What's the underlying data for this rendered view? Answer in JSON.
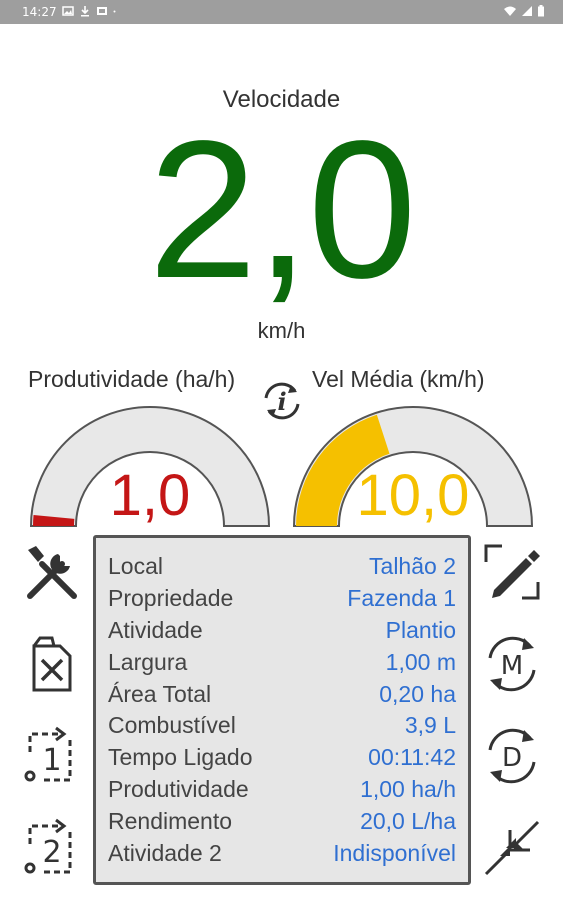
{
  "status_bar": {
    "time": "14:27",
    "left_icons": [
      "image-icon",
      "download-icon",
      "screenshot-icon",
      "dot-icon"
    ],
    "right_icons": [
      "wifi-icon",
      "signal-icon",
      "battery-icon"
    ]
  },
  "speed": {
    "label": "Velocidade",
    "value": "2,0",
    "unit": "km/h",
    "color": "#0b6a0b"
  },
  "gauges": {
    "productivity": {
      "label": "Produtividade (ha/h)",
      "value": "1,0",
      "fill_fraction": 0.03,
      "color": "#c41616"
    },
    "avg_speed": {
      "label": "Vel Média (km/h)",
      "value": "10,0",
      "fill_fraction": 0.4,
      "color": "#f5c000"
    }
  },
  "info_panel": {
    "rows": [
      {
        "key": "Local",
        "value": "Talhão 2"
      },
      {
        "key": "Propriedade",
        "value": "Fazenda 1"
      },
      {
        "key": "Atividade",
        "value": "Plantio"
      },
      {
        "key": "Largura",
        "value": "1,00 m"
      },
      {
        "key": "Área Total",
        "value": "0,20 ha"
      },
      {
        "key": "Combustível",
        "value": "3,9 L"
      },
      {
        "key": "Tempo Ligado",
        "value": "00:11:42"
      },
      {
        "key": "Produtividade",
        "value": "1,00 ha/h"
      },
      {
        "key": "Rendimento",
        "value": "20,0 L/ha"
      },
      {
        "key": "Atividade 2",
        "value": "Indisponível"
      }
    ]
  },
  "icons": {
    "left": [
      "tools-icon",
      "fuel-cancel-icon",
      "reset-1-icon",
      "reset-2-icon"
    ],
    "right": [
      "edit-icon",
      "manual-cycle-icon",
      "d-cycle-icon",
      "minimize-icon"
    ],
    "center": "info-cycle-icon"
  },
  "colors": {
    "value_text": "#2f6fd1",
    "panel_bg": "#e6e6e6",
    "gauge_track": "#e8e8e8"
  }
}
